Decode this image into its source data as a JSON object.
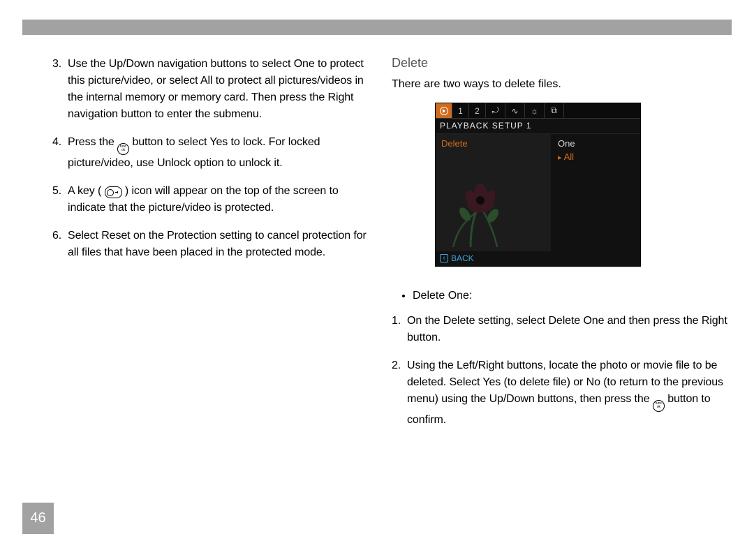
{
  "left_list_start": 3,
  "left_list": [
    "Use the Up/Down navigation buttons to select One to protect this picture/video, or select All to protect all pictures/videos in the internal memory or memory card. Then press the Right navigation button to enter the submenu.",
    {
      "before": "Press the ",
      "after": " button to select Yes to lock. For locked picture/video, use Unlock option to unlock it."
    },
    {
      "before": "A key ( ",
      "after": " ) icon will appear on the top of the screen to indicate that the picture/video is protected."
    },
    "Select Reset on the Protection setting to cancel protection for all files that have been placed in the protected mode."
  ],
  "right": {
    "heading": "Delete",
    "intro": "There are two ways to delete files.",
    "camera": {
      "header": "PLAYBACK SETUP 1",
      "tabs": [
        "",
        "1",
        "2",
        "⤾",
        "∿",
        "☼",
        "⧉"
      ],
      "left_label": "Delete",
      "options": [
        "One",
        "All"
      ],
      "selected_index": 1,
      "back_label": "BACK"
    },
    "bullet": "Delete One:",
    "steps_start": 1,
    "steps": [
      "On the Delete setting, select Delete One and then press the Right button.",
      {
        "before": "Using the Left/Right buttons, locate the photo or movie file to be deleted. Select Yes (to delete file) or No (to return to the previous menu) using the Up/Down buttons, then press the ",
        "after": " button to confirm."
      }
    ]
  },
  "page_number": "46"
}
